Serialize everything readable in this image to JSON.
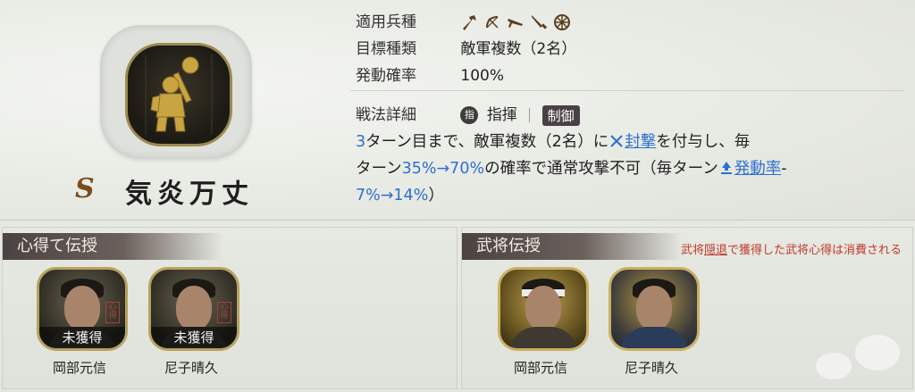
{
  "skill": {
    "rank": "S",
    "name": "気炎万丈"
  },
  "details": {
    "troop_label": "適用兵種",
    "troop_icons": [
      "spear-icon",
      "bow-icon",
      "gun-icon",
      "sword-icon",
      "wheel-icon"
    ],
    "target_label": "目標種類",
    "target_value": "敵軍複数（2名）",
    "rate_label": "発動確率",
    "rate_value": "100%",
    "tactic_label": "戦法詳細",
    "command_badge": "指",
    "command_type": "指揮",
    "category": "制御"
  },
  "description": {
    "turns": "3",
    "part1": "ターン目まで、敵軍複数（2名）に",
    "effect_name": "封撃",
    "part2": "を付与し、毎",
    "part3": "ターン",
    "rate_range": "35%→70%",
    "part4": "の確率で通常攻撃不可（毎ターン",
    "rate_stat": "発動率",
    "part5": "-",
    "rate_increase": "7%→14%",
    "part6": "）"
  },
  "left_panel": {
    "title": "心得て伝授",
    "generals": [
      {
        "name": "岡部元信",
        "status": "未獲得"
      },
      {
        "name": "尼子晴久",
        "status": "未獲得"
      }
    ]
  },
  "right_panel": {
    "title": "武将伝授",
    "warning_prefix": "武将",
    "warning_link": "隠退",
    "warning_suffix": "で獲得した武将心得は消費される",
    "generals": [
      {
        "name": "岡部元信"
      },
      {
        "name": "尼子晴久"
      }
    ]
  },
  "colors": {
    "accent_blue": "#2f6fd0",
    "warning_red": "#c0392b",
    "rank_brown": "#7a4b1c"
  }
}
